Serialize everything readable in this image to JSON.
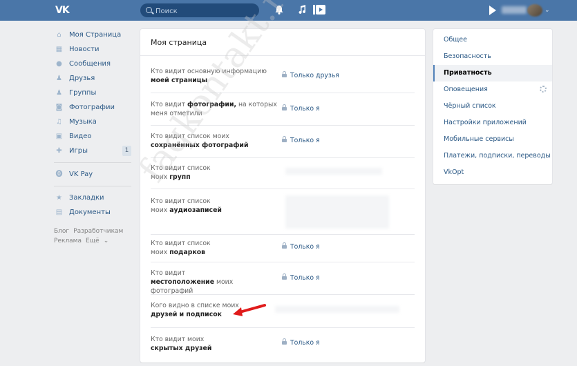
{
  "topbar": {
    "logo": "VK",
    "search_placeholder": "Поиск",
    "icons": [
      "bell-icon",
      "music-icon",
      "video-play-icon"
    ]
  },
  "leftnav": {
    "items": [
      {
        "label": "Моя Страница",
        "icon": "home-icon"
      },
      {
        "label": "Новости",
        "icon": "news-icon"
      },
      {
        "label": "Сообщения",
        "icon": "messages-icon"
      },
      {
        "label": "Друзья",
        "icon": "friends-icon"
      },
      {
        "label": "Группы",
        "icon": "groups-icon"
      },
      {
        "label": "Фотографии",
        "icon": "camera-icon"
      },
      {
        "label": "Музыка",
        "icon": "music-icon"
      },
      {
        "label": "Видео",
        "icon": "video-icon"
      },
      {
        "label": "Игры",
        "icon": "games-icon",
        "badge": "1"
      }
    ],
    "vkpay": {
      "label": "VK Pay",
      "icon": "vkpay-icon"
    },
    "extra": [
      {
        "label": "Закладки",
        "icon": "star-icon"
      },
      {
        "label": "Документы",
        "icon": "document-icon"
      }
    ],
    "footer": [
      "Блог",
      "Разработчикам",
      "Реклама",
      "Ещё"
    ]
  },
  "main": {
    "title": "Моя страница",
    "rows": [
      {
        "label_pre": "Кто видит основную информацию ",
        "label_bold": "моей страницы",
        "value": "Только друзья"
      },
      {
        "label_pre": "Кто видит ",
        "label_bold": "фотографии,",
        "label_post": " на которых меня отметили",
        "value": "Только я"
      },
      {
        "label_pre": "Кто видит список моих ",
        "label_bold": "сохранённых фотографий",
        "value": "Только я"
      },
      {
        "label_pre": "Кто видит список моих ",
        "label_bold": "групп",
        "value": ""
      },
      {
        "label_pre": "Кто видит список моих ",
        "label_bold": "аудиозаписей",
        "value": ""
      },
      {
        "label_pre": "Кто видит список моих ",
        "label_bold": "подарков",
        "value": "Только я"
      },
      {
        "label_pre": "Кто видит ",
        "label_bold": "местоположение",
        "label_post": " моих фотографий",
        "value": "Только я"
      },
      {
        "label_pre": "Кого видно в списке моих ",
        "label_bold": "друзей и подписок",
        "value": ""
      },
      {
        "label_pre": "Кто видит моих ",
        "label_bold": "скрытых друзей",
        "value": "Только я"
      }
    ]
  },
  "rightnav": {
    "items": [
      "Общее",
      "Безопасность",
      "Приватность",
      "Оповещения",
      "Чёрный список",
      "Настройки приложений",
      "Мобильные сервисы",
      "Платежи, подписки, переводы",
      "VkOpt"
    ],
    "active": "Приватность"
  },
  "watermark": "faqkontakt.ru",
  "colors": {
    "header": "#4a76a8",
    "link": "#2a5885",
    "arrow": "#e01b1b"
  }
}
